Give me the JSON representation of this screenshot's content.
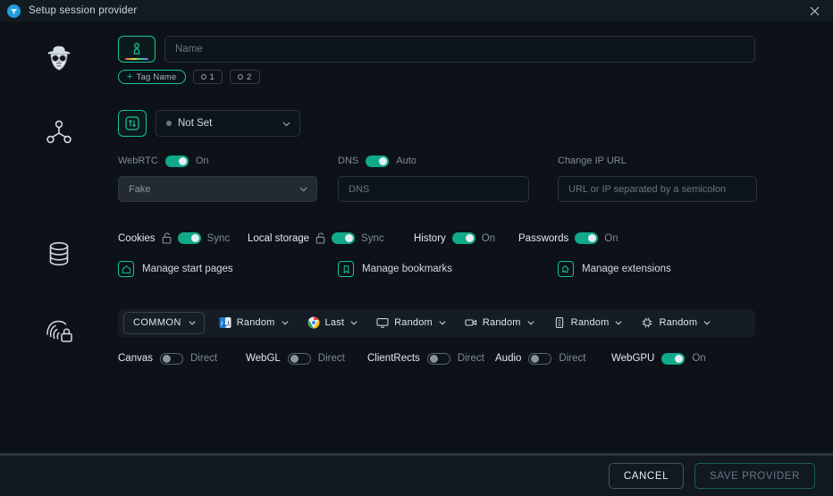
{
  "window": {
    "title": "Setup session provider",
    "logo_icon": "browser-logo-icon",
    "close_icon": "close-icon"
  },
  "identity": {
    "gutter_icon": "heisenberg-avatar-icon",
    "avatar_button_icon": "profile-laptop-icon",
    "name_placeholder": "Name",
    "name_value": "",
    "tags": [
      {
        "label": "Tag Name",
        "icon": "plus-icon",
        "style": "accent"
      },
      {
        "label": "1",
        "icon": "ring-icon",
        "style": "plain"
      },
      {
        "label": "2",
        "icon": "ring-icon",
        "style": "plain"
      }
    ]
  },
  "proxy": {
    "gutter_icon": "network-share-icon",
    "type_button_icon": "transfer-arrows-icon",
    "selected_type": "Not Set",
    "chevron_icon": "chevron-down-icon",
    "webrtc": {
      "label": "WebRTC",
      "state": "On",
      "toggle": "on",
      "mode": "Fake"
    },
    "dns": {
      "label": "DNS",
      "state": "Auto",
      "toggle": "on",
      "placeholder": "DNS",
      "value": ""
    },
    "change_ip": {
      "label": "Change IP URL",
      "placeholder": "URL or IP separated by a semicolon",
      "value": ""
    }
  },
  "storage": {
    "gutter_icon": "database-icon",
    "toggles": [
      {
        "name": "Cookies",
        "state": "Sync",
        "toggle": "on",
        "lock_icon": "unlock-icon"
      },
      {
        "name": "Local storage",
        "state": "Sync",
        "toggle": "on",
        "lock_icon": "unlock-icon"
      },
      {
        "name": "History",
        "state": "On",
        "toggle": "on",
        "lock_icon": null
      },
      {
        "name": "Passwords",
        "state": "On",
        "toggle": "on",
        "lock_icon": null
      }
    ],
    "manage": [
      {
        "label": "Manage start pages",
        "icon": "home-icon"
      },
      {
        "label": "Manage bookmarks",
        "icon": "bookmark-icon"
      },
      {
        "label": "Manage extensions",
        "icon": "extension-puzzle-icon"
      }
    ]
  },
  "fingerprint": {
    "gutter_icon": "fingerprint-lock-icon",
    "preset": "COMMON",
    "selectors": [
      {
        "icon": "os-finder-icon",
        "value": "Random"
      },
      {
        "icon": "chrome-icon",
        "value": "Last"
      },
      {
        "icon": "monitor-icon",
        "value": "Random"
      },
      {
        "icon": "webcam-icon",
        "value": "Random"
      },
      {
        "icon": "memory-chip-icon",
        "value": "Random"
      },
      {
        "icon": "cpu-chip-icon",
        "value": "Random"
      }
    ],
    "toggles": [
      {
        "name": "Canvas",
        "state": "Direct",
        "toggle": "off"
      },
      {
        "name": "WebGL",
        "state": "Direct",
        "toggle": "off"
      },
      {
        "name": "ClientRects",
        "state": "Direct",
        "toggle": "off"
      },
      {
        "name": "Audio",
        "state": "Direct",
        "toggle": "off"
      },
      {
        "name": "WebGPU",
        "state": "On",
        "toggle": "on"
      }
    ]
  },
  "footer": {
    "cancel_label": "CANCEL",
    "save_label": "SAVE PROVIDER"
  },
  "colors": {
    "accent": "#17c39a",
    "toggle_on": "#11a98a",
    "background": "#0c1218",
    "panel": "#151c25",
    "titlebar": "#121a22",
    "logo_blue": "#1e9fdd"
  }
}
